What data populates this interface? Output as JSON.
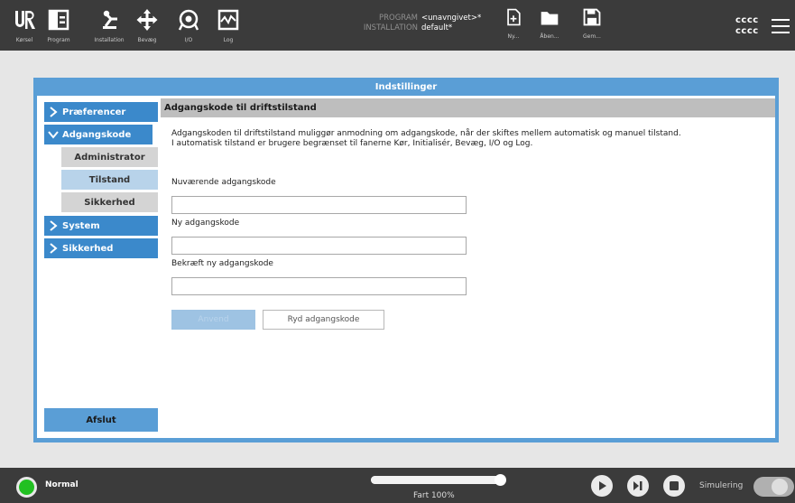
{
  "topbar": {
    "nav": [
      {
        "label": "Kørsel",
        "icon": "ur-logo-icon"
      },
      {
        "label": "Program",
        "icon": "program-icon"
      },
      {
        "label": "Installation",
        "icon": "installation-icon"
      },
      {
        "label": "Bevæg",
        "icon": "move-icon"
      },
      {
        "label": "I/O",
        "icon": "io-icon"
      },
      {
        "label": "Log",
        "icon": "log-icon"
      }
    ],
    "program_key": "PROGRAM",
    "program_value": "<unavngivet>*",
    "installation_key": "INSTALLATION",
    "installation_value": "default*",
    "file_actions": [
      {
        "label": "Ny...",
        "icon": "new-file-icon"
      },
      {
        "label": "Åben...",
        "icon": "open-folder-icon"
      },
      {
        "label": "Gem...",
        "icon": "save-icon"
      }
    ],
    "user_line1": "cccc",
    "user_line2": "cccc",
    "menu_icon": "hamburger-menu-icon"
  },
  "dialog": {
    "title": "Indstillinger",
    "sidebar": {
      "items": [
        {
          "label": "Præferencer",
          "expanded": false
        },
        {
          "label": "Adgangskode",
          "expanded": true,
          "children": [
            {
              "label": "Administrator",
              "active": false
            },
            {
              "label": "Tilstand",
              "active": true
            },
            {
              "label": "Sikkerhed",
              "active": false
            }
          ]
        },
        {
          "label": "System",
          "expanded": false
        },
        {
          "label": "Sikkerhed",
          "expanded": false
        }
      ],
      "exit_label": "Afslut"
    },
    "content": {
      "heading": "Adgangskode til driftstilstand",
      "description_line1": "Adgangskoden til driftstilstand muliggør anmodning om adgangskode, når der skiftes mellem automatisk og manuel tilstand.",
      "description_line2": "I automatisk tilstand er brugere begrænset til fanerne Kør, Initialisér, Bevæg, I/O og Log.",
      "current_label": "Nuværende adgangskode",
      "current_value": "",
      "new_label": "Ny adgangskode",
      "new_value": "",
      "confirm_label": "Bekræft ny adgangskode",
      "confirm_value": "",
      "apply_label": "Anvend",
      "clear_label": "Ryd adgangskode"
    }
  },
  "bottombar": {
    "status": "Normal",
    "status_color": "#22c022",
    "speed_label": "Fart 100%",
    "speed_fraction": 1.0,
    "simulation_label": "Simulering",
    "simulation_on": false
  }
}
